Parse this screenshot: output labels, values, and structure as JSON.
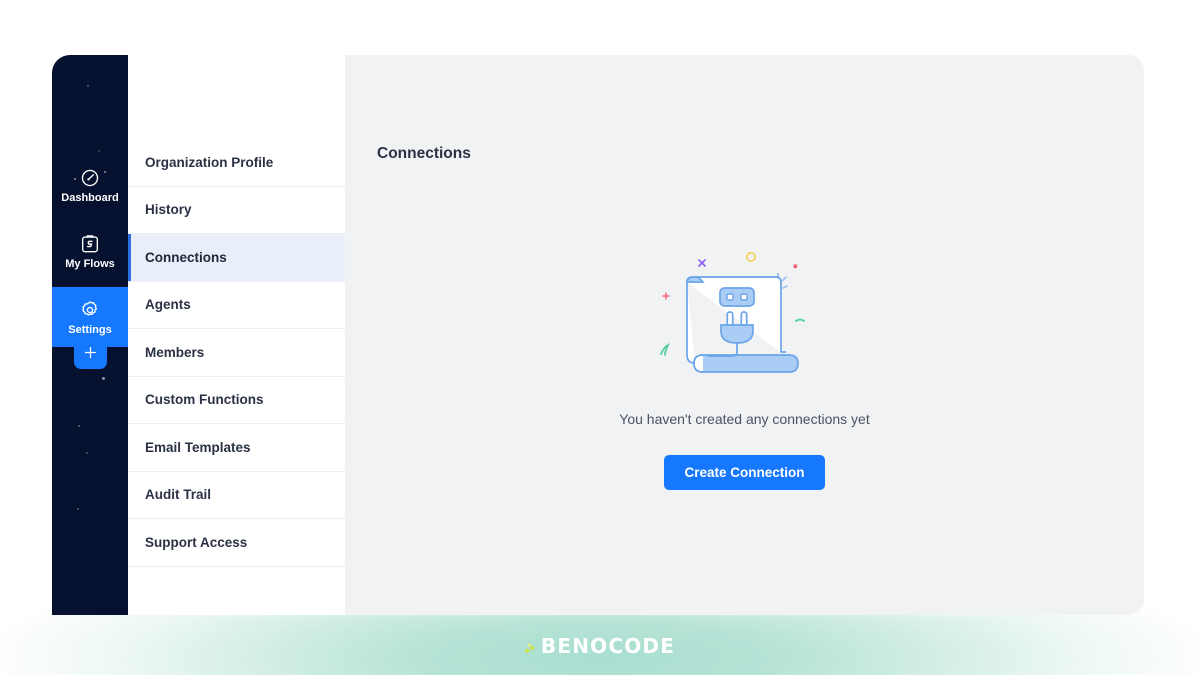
{
  "colors": {
    "rail_bg": "#061130",
    "accent": "#1677ff",
    "active_menu_bg": "#e9eefb",
    "panel_bg": "#f1f2f4",
    "text": "#2b3245",
    "illustration_blue": "#8cb8f0",
    "brand_mark": "#cde04a"
  },
  "rail": {
    "items": [
      {
        "label": "Dashboard",
        "icon": "speedometer-icon",
        "active": false
      },
      {
        "label": "My Flows",
        "icon": "clipboard-flow-icon",
        "active": false
      },
      {
        "label": "Settings",
        "icon": "gear-icon",
        "active": true
      }
    ],
    "add_button": {
      "icon": "plus-icon",
      "label": "+"
    }
  },
  "settings_menu": {
    "items": [
      {
        "label": "Organization Profile",
        "active": false
      },
      {
        "label": "History",
        "active": false
      },
      {
        "label": "Connections",
        "active": true
      },
      {
        "label": "Agents",
        "active": false
      },
      {
        "label": "Members",
        "active": false
      },
      {
        "label": "Custom Functions",
        "active": false
      },
      {
        "label": "Email Templates",
        "active": false
      },
      {
        "label": "Audit Trail",
        "active": false
      },
      {
        "label": "Support Access",
        "active": false
      }
    ]
  },
  "content": {
    "title": "Connections",
    "empty_state": {
      "illustration": "plug-and-socket-illustration",
      "message": "You haven't created any connections yet",
      "cta_label": "Create Connection"
    }
  },
  "footer": {
    "brand_name": "BENOCODE",
    "brand_mark": "benocode-logo-mark"
  }
}
